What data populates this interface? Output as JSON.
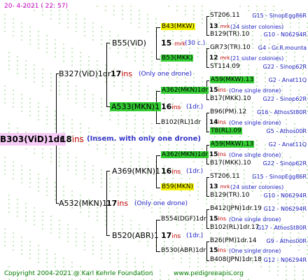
{
  "date": "20-   4-2021  (  22:  57)",
  "footer": {
    "copyright": "Copyright 2004-2021 @ Karl Kehrle Foundation",
    "url": "www.pedigreeapis.org"
  },
  "watermark_color": "#c8e8c0",
  "root": {
    "name": "B303(ViD)1dr",
    "ins_num": "18",
    "ins_label": "ins",
    "note": "(Insem. with only one drone)"
  },
  "gen1": [
    {
      "name": "B327(ViD)1dr",
      "ins_num": "17",
      "ins_label": "ins",
      "note": "(Only one drone)"
    },
    {
      "name": "A532(MKN)1",
      "ins_num": "17",
      "ins_label": "ins",
      "note": "(Only one drone)"
    }
  ],
  "gen2": [
    {
      "name": "B55(ViD)",
      "ins_num": "15",
      "ins_label": "mrk",
      "note": "(30 c.)"
    },
    {
      "name": "A533(MKN)1",
      "ins_num": "16",
      "ins_label": "ins",
      "note": "(1dr.)"
    },
    {
      "name": "A369(MKN)1",
      "ins_num": "16",
      "ins_label": "ins",
      "note": "(1dr.)"
    },
    {
      "name": "B520(ABR)1",
      "ins_num": "17",
      "ins_label": "ins",
      "note": "(1dr.)"
    }
  ],
  "gen3": [
    {
      "name": "B43(MKW)",
      "ins_num": "13",
      "ins_label": "mrk",
      "note": "(24 sister colonies)"
    },
    {
      "name": "B53(MKK)",
      "ins_num": "12",
      "ins_label": "mrk",
      "note": "(21 sister colonies)"
    },
    {
      "name": "A362(MKN)1dr",
      "ins_num": "15",
      "ins_label": "ins",
      "note": "(One single drone)"
    },
    {
      "name": "B102(RL)1dr",
      "ins_num": "14",
      "ins_label": "ins",
      "note": "(One single drone)"
    },
    {
      "name": "A362(MKN)1dr",
      "ins_num": "15",
      "ins_label": "ins",
      "note": "(One single drone)"
    },
    {
      "name": "B59(MKN)",
      "ins_num": "13",
      "ins_label": "mrk",
      "note": "(24 sister colonies)"
    },
    {
      "name": "B554(DGF)1dr",
      "ins_num": "15",
      "ins_label": "ins",
      "note": "(One single drone)"
    },
    {
      "name": "B530(ABR)1dr",
      "ins_num": "15",
      "ins_label": "ins",
      "note": "(One single drone)"
    }
  ],
  "gen4": [
    {
      "name": "ST206.11",
      "info": "G15 - SinopEgg86R"
    },
    {
      "name": "B129(TR).10",
      "info": "G10 - N06294R"
    },
    {
      "name": "GR73(TR).10",
      "info": "G4 - Gr.R.mounta"
    },
    {
      "name": "ST114.09",
      "info": "G22 - Sinop62R"
    },
    {
      "name": "A59(MKW).13",
      "info": "G2 - Anat11Q"
    },
    {
      "name": "B17(MKK).10",
      "info": "G22 - Sinop62R"
    },
    {
      "name": "B96(PM).12",
      "info": "G16 - AthosSt80R"
    },
    {
      "name": "T8(RL).09",
      "info": "G5 - Athos00R"
    },
    {
      "name": "A59(MKW).13",
      "info": "G2 - Anat11Q"
    },
    {
      "name": "B17(MKK).10",
      "info": "G22 - Sinop62R"
    },
    {
      "name": "ST206.11",
      "info": "G15 - SinopEgg86R"
    },
    {
      "name": "B129(TR).10",
      "info": "G10 - N06294R"
    },
    {
      "name": "B412(JPN)1dr.19",
      "info": "G12 - N06294R"
    },
    {
      "name": "B102(RL)1dr.17",
      "info": "G17 - AthosSt80R"
    },
    {
      "name": "B26(PM)1dr.14",
      "info": "G9 - Athos00R"
    },
    {
      "name": "B408(JPN)1dr.18",
      "info": "G12 - N06294R"
    }
  ]
}
